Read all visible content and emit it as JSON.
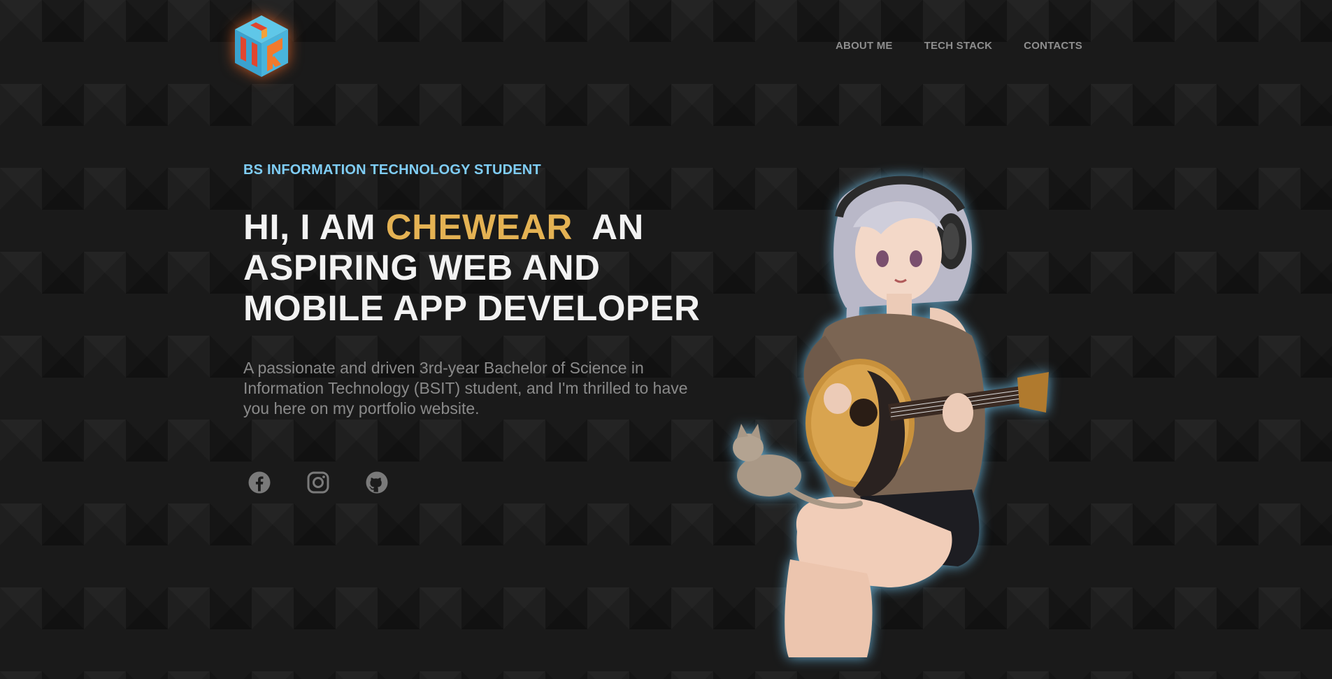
{
  "nav": {
    "logo_icon": "cube-logo-icon",
    "items": [
      {
        "label": "ABOUT ME"
      },
      {
        "label": "TECH STACK"
      },
      {
        "label": "CONTACTS"
      }
    ]
  },
  "hero": {
    "eyebrow": "BS INFORMATION TECHNOLOGY STUDENT",
    "headline_prefix": "HI, I AM ",
    "headline_name": "CHEWEAR",
    "headline_suffix": "  AN ASPIRING WEB AND MOBILE APP DEVELOPER",
    "description": "A passionate and driven 3rd-year Bachelor of Science in Information Technology (BSIT) student, and I'm thrilled to have you here on my portfolio website."
  },
  "socials": [
    {
      "icon": "facebook-icon"
    },
    {
      "icon": "instagram-icon"
    },
    {
      "icon": "github-icon"
    }
  ],
  "illustration": {
    "icon": "anime-girl-guitar-illustration"
  },
  "colors": {
    "background": "#1a1a1a",
    "accent_name": "#e4b253",
    "eyebrow": "#7fcdf5",
    "nav_text": "#8e8e8e",
    "body_text": "#8a8a8a",
    "headline": "#f2f2f2",
    "icon": "#7a7a7a"
  }
}
